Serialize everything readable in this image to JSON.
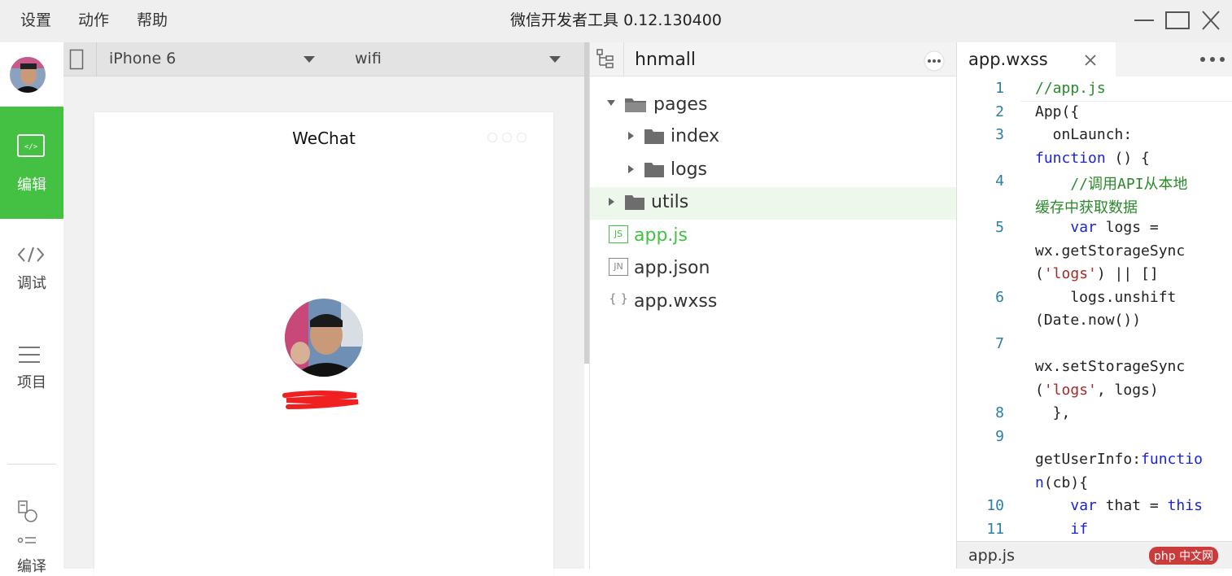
{
  "window": {
    "title": "微信开发者工具 0.12.130400",
    "menu": [
      "设置",
      "动作",
      "帮助"
    ]
  },
  "sidebar": {
    "items": [
      {
        "label": "编辑",
        "icon": "code-editor-icon",
        "active": true
      },
      {
        "label": "调试",
        "icon": "code-brackets-icon"
      },
      {
        "label": "项目",
        "icon": "menu-lines-icon"
      },
      {
        "label": "编译",
        "icon": "compile-icon"
      }
    ]
  },
  "simulator": {
    "device": "iPhone 6",
    "network": "wifi",
    "nav_title": "WeChat"
  },
  "file_tree": {
    "project": "hnmall",
    "items": [
      {
        "label": "pages",
        "type": "folder",
        "expanded": true
      },
      {
        "label": "index",
        "type": "folder"
      },
      {
        "label": "logs",
        "type": "folder"
      },
      {
        "label": "utils",
        "type": "folder",
        "selected": true
      },
      {
        "label": "app.js",
        "type": "js",
        "badge": "JS",
        "active": true
      },
      {
        "label": "app.json",
        "type": "json",
        "badge": "JN"
      },
      {
        "label": "app.wxss",
        "type": "wxss",
        "badge": "{ }"
      }
    ]
  },
  "editor": {
    "tab_label": "app.wxss",
    "status_file": "app.js",
    "watermark": "php 中文网",
    "line_numbers": [
      "1",
      "2",
      "3",
      "4",
      "5",
      "6",
      "7",
      "8",
      "9",
      "10",
      "11"
    ]
  },
  "colors": {
    "accent_green": "#44c043",
    "keyword_blue": "#1a24d8",
    "comment_green": "#2a8a2a",
    "string_red": "#a52a2a",
    "line_number": "#2a7fa6"
  }
}
